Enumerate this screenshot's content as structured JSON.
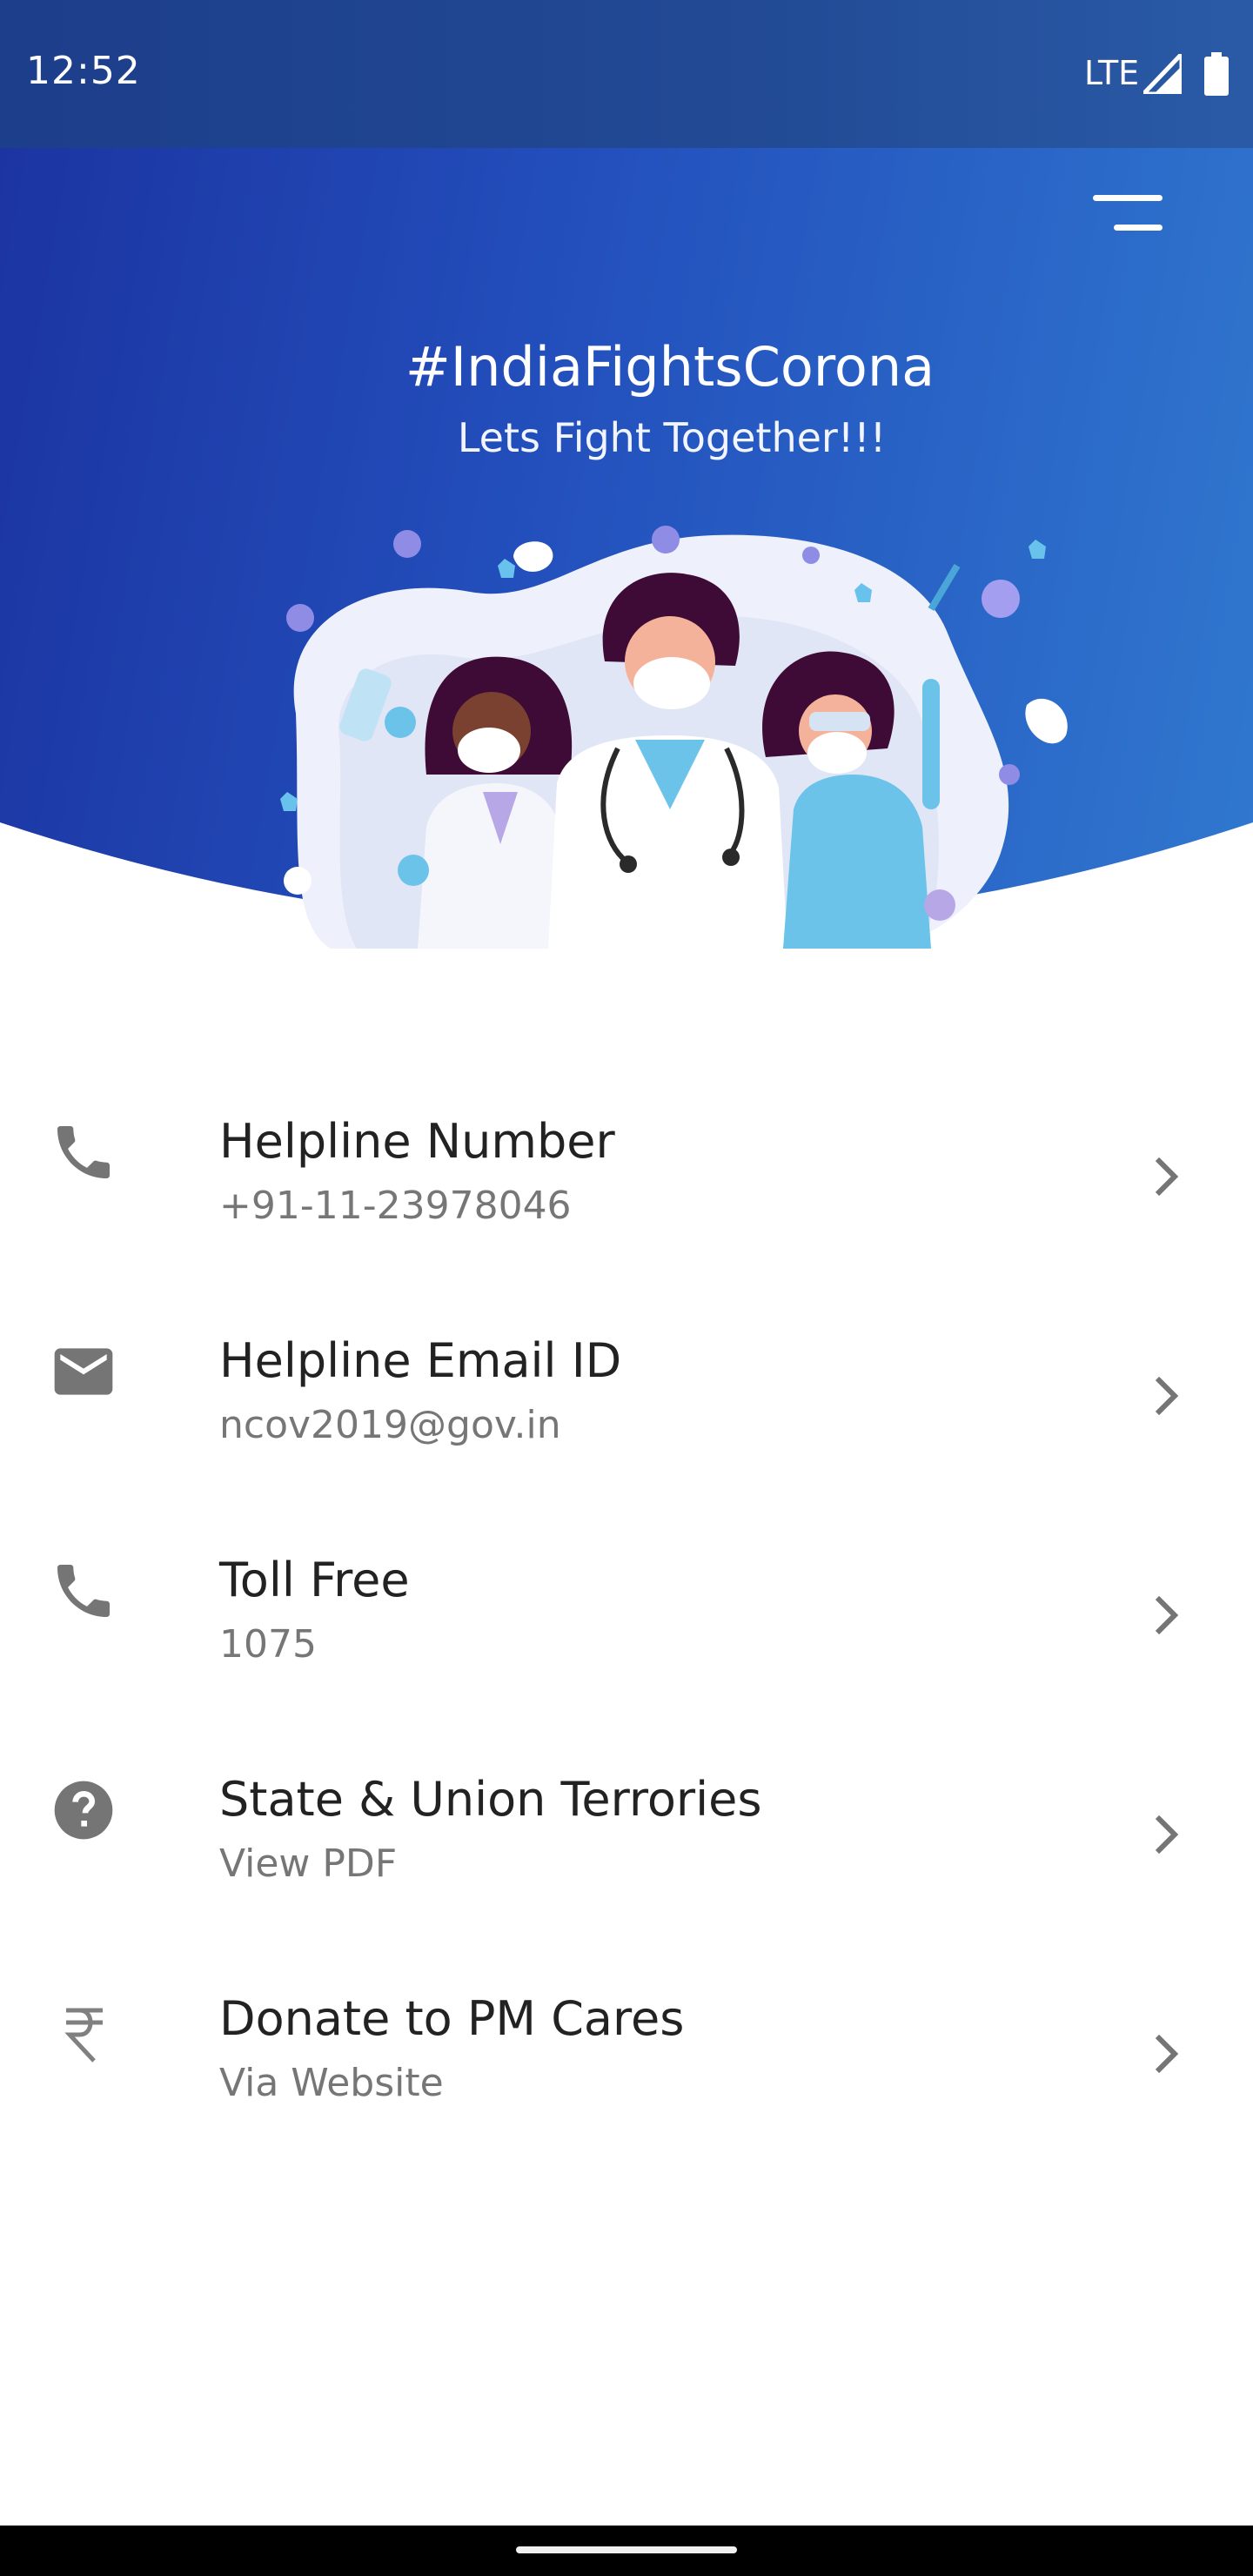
{
  "status_bar": {
    "time": "12:52",
    "network": "LTE"
  },
  "header": {
    "title": "#IndiaFightsCorona",
    "subtitle": "Lets Fight Together!!!",
    "menu_icon": "menu-icon"
  },
  "items": [
    {
      "icon": "phone-icon",
      "label": "Helpline Number",
      "sub": "+91-11-23978046"
    },
    {
      "icon": "email-icon",
      "label": "Helpline Email ID",
      "sub": "ncov2019@gov.in"
    },
    {
      "icon": "phone-icon",
      "label": "Toll Free",
      "sub": "1075"
    },
    {
      "icon": "help-icon",
      "label": "State & Union Terrories",
      "sub": "View PDF"
    },
    {
      "icon": "rupee-icon",
      "label": "Donate to PM Cares",
      "sub": "Via Website"
    }
  ],
  "colors": {
    "header_gradient_start": "#1b33a0",
    "header_gradient_end": "#3078cf",
    "icon_gray": "#757575",
    "primary_text": "#222222",
    "secondary_text": "#767676"
  }
}
